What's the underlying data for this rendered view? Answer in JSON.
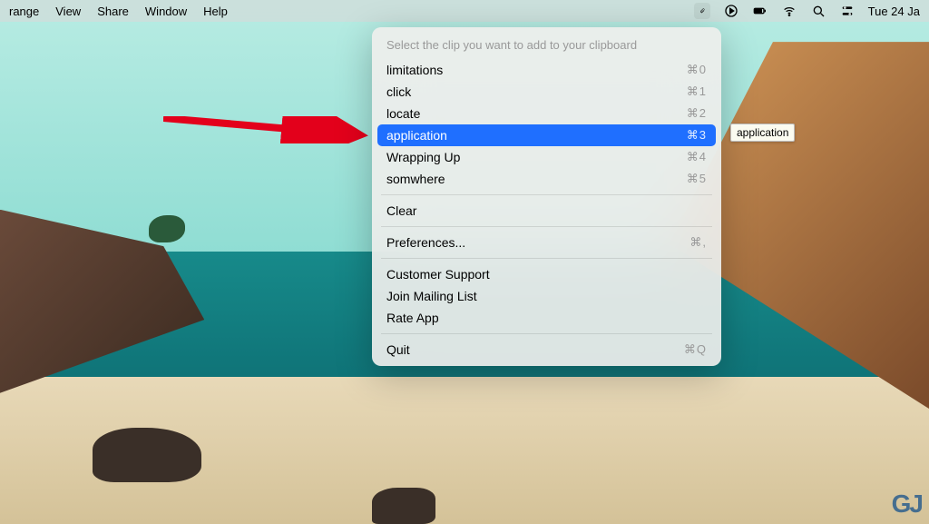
{
  "menubar": {
    "left_items": [
      "range",
      "View",
      "Share",
      "Window",
      "Help"
    ],
    "date": "Tue 24 Ja"
  },
  "dropdown": {
    "header": "Select the clip you want to add to your clipboard",
    "clips": [
      {
        "label": "limitations",
        "shortcut": "⌘0",
        "active": false
      },
      {
        "label": "click",
        "shortcut": "⌘1",
        "active": false
      },
      {
        "label": "locate",
        "shortcut": "⌘2",
        "active": false
      },
      {
        "label": "application",
        "shortcut": "⌘3",
        "active": true
      },
      {
        "label": "Wrapping Up",
        "shortcut": "⌘4",
        "active": false
      },
      {
        "label": "somwhere",
        "shortcut": "⌘5",
        "active": false
      }
    ],
    "clear": {
      "label": "Clear",
      "shortcut": ""
    },
    "prefs": {
      "label": "Preferences...",
      "shortcut": "⌘,"
    },
    "extra": [
      {
        "label": "Customer Support"
      },
      {
        "label": "Join Mailing List"
      },
      {
        "label": "Rate App"
      }
    ],
    "quit": {
      "label": "Quit",
      "shortcut": "⌘Q"
    }
  },
  "tooltip": "application",
  "watermark": "GJ"
}
